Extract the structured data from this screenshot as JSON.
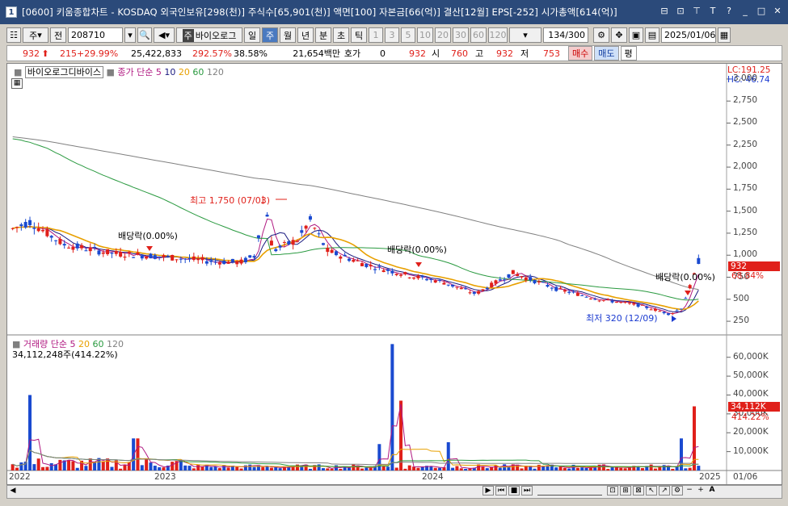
{
  "window": {
    "number": "1",
    "title": "[0600] 키움종합차트 - KOSDAQ 외국인보유[298(천)] 주식수[65,901(천)] 액면[100] 자본금[66(억)] 결산[12월] EPS[-252] 시가총액[614(억)]",
    "controls": [
      "⊟",
      "⊡",
      "📌",
      "T",
      "?",
      "_",
      "□",
      "✕"
    ]
  },
  "toolbar": {
    "period_type": "주",
    "prev_label": "전",
    "code": "208710",
    "indicator_name": "바이오로그",
    "timeframes": [
      "일",
      "주",
      "월",
      "년",
      "분",
      "초",
      "틱"
    ],
    "timeframe_selected": "주",
    "minute_options": [
      "1",
      "3",
      "5",
      "10",
      "20",
      "30",
      "60",
      "120"
    ],
    "count": "134",
    "count_max": "/300",
    "date": "2025/01/06"
  },
  "quote": {
    "price": "932",
    "change": "215",
    "change_pct": "+29.99%",
    "volume": "25,422,833",
    "volume_pct": "292.57%",
    "turnover": "38.58%",
    "amount": "21,654백만",
    "hoga_label": "호가",
    "hoga_value": "0",
    "hoga_price": "932",
    "open_label": "시",
    "open": "760",
    "high_label": "고",
    "high": "932",
    "low_label": "저",
    "low": "753",
    "buy_label": "매수",
    "sell_label": "매도",
    "eval_label": "평"
  },
  "price_panel": {
    "stock_name": "바이오로그디바이스",
    "ma_label": "종가 단순",
    "ma_periods": [
      "5",
      "10",
      "20",
      "60",
      "120"
    ],
    "ma_colors": [
      "#b01880",
      "#1a1a80",
      "#e8a000",
      "#2a9a40",
      "#808080"
    ],
    "lc": "LC:191.25",
    "hc": "HC:-46.74",
    "current_price_tag": "932",
    "current_pct_tag": "68.84%",
    "annotations": [
      {
        "text": "최고 1,750 (07/03)",
        "color": "#e0201a"
      },
      {
        "text": "배당락(0.00%)",
        "color": "#000000"
      },
      {
        "text": "배당락(0.00%)",
        "color": "#000000"
      },
      {
        "text": "배당락(0.00%)",
        "color": "#000000"
      },
      {
        "text": "최저 320 (12/09)",
        "color": "#1a3ad0"
      }
    ],
    "y_ticks": [
      "3,000",
      "2,750",
      "2,500",
      "2,250",
      "2,000",
      "1,750",
      "1,500",
      "1,250",
      "1,000",
      "750",
      "500",
      "250"
    ]
  },
  "volume_panel": {
    "label": "거래량",
    "ma_label": "단순",
    "ma_periods": [
      "5",
      "20",
      "60",
      "120"
    ],
    "volume_text": "34,112,248주(414.22%)",
    "current_tag": "34,112K",
    "current_pct_tag": "414.22%",
    "y_ticks": [
      "60,000K",
      "50,000K",
      "40,000K",
      "30,000K",
      "20,000K",
      "10,000K"
    ]
  },
  "x_axis": [
    "2022",
    "2023",
    "2024",
    "2025",
    "01/06"
  ],
  "chart_data": {
    "type": "candlestick",
    "price_ylim": [
      150,
      3100
    ],
    "volume_ylim": [
      0,
      68000
    ],
    "high_point": {
      "value": 1750,
      "date": "07/03"
    },
    "low_point": {
      "value": 320,
      "date": "12/09"
    }
  }
}
